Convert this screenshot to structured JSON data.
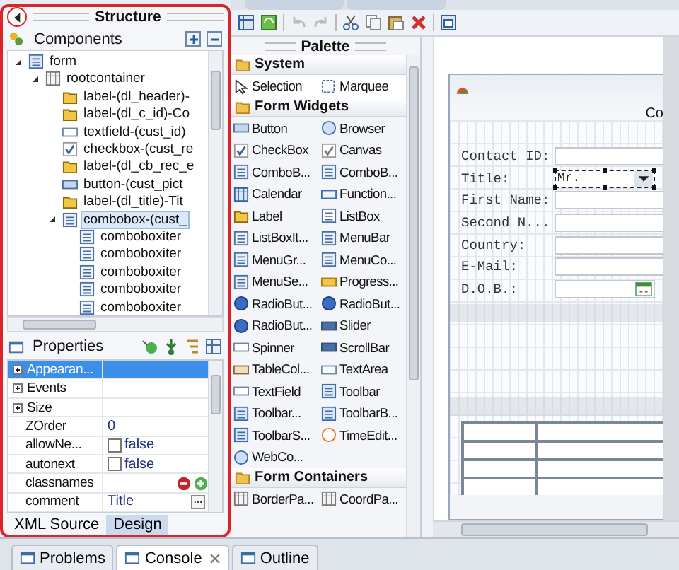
{
  "structure": {
    "title": "Structure",
    "components": "Components",
    "tree": [
      {
        "label": "form",
        "kind": "form",
        "expanded": true,
        "selected": false,
        "children": [
          {
            "label": "rootcontainer",
            "kind": "coord",
            "expanded": true,
            "selected": false,
            "children": [
              {
                "label": "label-(dl_header)-",
                "kind": "label",
                "selected": false
              },
              {
                "label": "label-(dl_c_id)-Co",
                "kind": "label",
                "selected": false
              },
              {
                "label": "textfield-(cust_id)",
                "kind": "textfield",
                "selected": false
              },
              {
                "label": "checkbox-(cust_re",
                "kind": "checkbox",
                "selected": false
              },
              {
                "label": "label-(dl_cb_rec_e",
                "kind": "label",
                "selected": false
              },
              {
                "label": "button-(cust_pict",
                "kind": "button",
                "selected": false
              },
              {
                "label": "label-(dl_title)-Tit",
                "kind": "label",
                "selected": false
              },
              {
                "label": "combobox-(cust_",
                "kind": "combobox",
                "expanded": true,
                "selected": true,
                "children": [
                  {
                    "label": "comboboxiter",
                    "kind": "comboitem",
                    "selected": false
                  },
                  {
                    "label": "comboboxiter",
                    "kind": "comboitem",
                    "selected": false
                  },
                  {
                    "label": "comboboxiter",
                    "kind": "comboitem",
                    "selected": false
                  },
                  {
                    "label": "comboboxiter",
                    "kind": "comboitem",
                    "selected": false
                  },
                  {
                    "label": "comboboxiter",
                    "kind": "comboitem",
                    "selected": false
                  }
                ]
              }
            ]
          }
        ]
      }
    ]
  },
  "properties": {
    "title": "Properties",
    "rows": [
      {
        "name": "Appearan...",
        "kind": "group",
        "expanded": false,
        "selected": true
      },
      {
        "name": "Events",
        "kind": "group",
        "expanded": false,
        "selected": false
      },
      {
        "name": "Size",
        "kind": "group",
        "expanded": false,
        "selected": false
      },
      {
        "name": "ZOrder",
        "kind": "text",
        "value": "0",
        "selected": false
      },
      {
        "name": "allowNe...",
        "kind": "checkbox",
        "checked": false,
        "value": "false",
        "selected": false
      },
      {
        "name": "autonext",
        "kind": "checkbox",
        "checked": false,
        "value": "false",
        "selected": false
      },
      {
        "name": "classnames",
        "kind": "list",
        "selected": false
      },
      {
        "name": "comment",
        "kind": "dialog",
        "value": "Title",
        "selected": false
      }
    ]
  },
  "editor_views": [
    {
      "label": "XML Source",
      "selected": false
    },
    {
      "label": "Design",
      "selected": true
    }
  ],
  "palette": {
    "title": "Palette",
    "groups": [
      {
        "name": "System",
        "items": [
          {
            "label": "Selection",
            "kind": "pointer"
          },
          {
            "label": "Marquee",
            "kind": "marquee"
          }
        ]
      },
      {
        "name": "Form Widgets",
        "items": [
          {
            "label": "Button",
            "kind": "button"
          },
          {
            "label": "Browser",
            "kind": "browser"
          },
          {
            "label": "CheckBox",
            "kind": "checkbox"
          },
          {
            "label": "Canvas",
            "kind": "canvas"
          },
          {
            "label": "ComboB...",
            "kind": "combobox"
          },
          {
            "label": "ComboB...",
            "kind": "combobox"
          },
          {
            "label": "Calendar",
            "kind": "calendar"
          },
          {
            "label": "Function...",
            "kind": "function"
          },
          {
            "label": "Label",
            "kind": "label"
          },
          {
            "label": "ListBox",
            "kind": "listbox"
          },
          {
            "label": "ListBoxIt...",
            "kind": "comboitem"
          },
          {
            "label": "MenuBar",
            "kind": "menu"
          },
          {
            "label": "MenuGr...",
            "kind": "menu"
          },
          {
            "label": "MenuCo...",
            "kind": "menu"
          },
          {
            "label": "MenuSe...",
            "kind": "menu"
          },
          {
            "label": "Progress...",
            "kind": "progress"
          },
          {
            "label": "RadioBut...",
            "kind": "radio"
          },
          {
            "label": "RadioBut...",
            "kind": "radio"
          },
          {
            "label": "RadioBut...",
            "kind": "radio"
          },
          {
            "label": "Slider",
            "kind": "slider"
          },
          {
            "label": "Spinner",
            "kind": "textfield"
          },
          {
            "label": "ScrollBar",
            "kind": "slider"
          },
          {
            "label": "TableCol...",
            "kind": "table"
          },
          {
            "label": "TextArea",
            "kind": "textfield"
          },
          {
            "label": "TextField",
            "kind": "textfield"
          },
          {
            "label": "Toolbar",
            "kind": "toolbar"
          },
          {
            "label": "Toolbar...",
            "kind": "toolbar"
          },
          {
            "label": "ToolbarB...",
            "kind": "toolbar"
          },
          {
            "label": "ToolbarS...",
            "kind": "toolbar"
          },
          {
            "label": "TimeEdit...",
            "kind": "clock"
          },
          {
            "label": "WebCo...",
            "kind": "browser"
          }
        ]
      },
      {
        "name": "Form Containers",
        "items": [
          {
            "label": "BorderPa...",
            "kind": "coord"
          },
          {
            "label": "CoordPa...",
            "kind": "coord"
          }
        ]
      }
    ]
  },
  "design": {
    "form_title": "Co",
    "fields": [
      {
        "label": "Contact ID:",
        "kind": "text",
        "selected": false
      },
      {
        "label": "Title:",
        "kind": "combo",
        "value": "Mr.",
        "selected": true
      },
      {
        "label": "First Name:",
        "kind": "text",
        "selected": false
      },
      {
        "label": "Second N...",
        "kind": "text",
        "selected": false
      },
      {
        "label": "Country:",
        "kind": "text",
        "selected": false
      },
      {
        "label": "E-Mail:",
        "kind": "text",
        "selected": false
      },
      {
        "label": "D.O.B.:",
        "kind": "date",
        "selected": false
      }
    ]
  },
  "bottom_views": [
    {
      "label": "Problems",
      "selected": false
    },
    {
      "label": "Console",
      "selected": true
    },
    {
      "label": "Outline",
      "selected": false
    }
  ]
}
